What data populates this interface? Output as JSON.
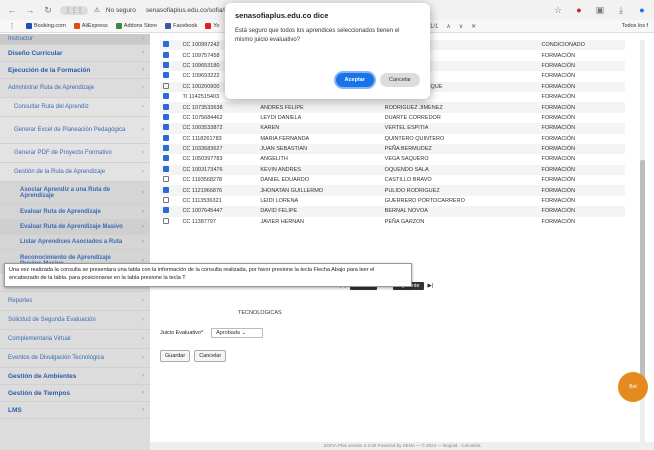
{
  "browser": {
    "url_pill": "⋮⋮⋮",
    "insecure_label": "No seguro",
    "url": "senasofiaplus.edu.co/sofia/home/principal.faces",
    "bookmarks": [
      {
        "label": "Booking.com",
        "color": "#1e4fb8"
      },
      {
        "label": "AliExpress",
        "color": "#e04b1e"
      },
      {
        "label": "Addons Store",
        "color": "#3b8b3b"
      },
      {
        "label": "Facebook",
        "color": "#3b5998"
      },
      {
        "label": "Yo",
        "color": "#e02020"
      }
    ],
    "bookmarks_right": "Todos los f",
    "find_count": "1/1"
  },
  "sidebar": {
    "items": [
      {
        "label": "Instructor",
        "kind": "top"
      },
      {
        "label": "Diseño Curricular",
        "kind": "section"
      },
      {
        "label": "Ejecución de la Formación",
        "kind": "section"
      },
      {
        "label": "Administrar Ruta de Aprendizaje",
        "kind": "plain"
      },
      {
        "label": "Consultar Ruta del Aprendiz",
        "kind": "sub"
      },
      {
        "label": "Generar Excel de Planeación Pedagógica",
        "kind": "sub"
      },
      {
        "label": "Generar PDF de Proyecto Formativo",
        "kind": "sub"
      },
      {
        "label": "Gestión de la Ruta de Aprendizaje",
        "kind": "sub"
      },
      {
        "label": "Asociar Aprendiz a una Ruta de Aprendizaje",
        "kind": "sub2"
      },
      {
        "label": "Evaluar Ruta de Aprendizaje",
        "kind": "sub2"
      },
      {
        "label": "Evaluar Ruta de Aprendizaje Masivo",
        "kind": "sub2hl"
      },
      {
        "label": "Listar Aprendices Asociados a Ruta",
        "kind": "sub2"
      },
      {
        "label": "Reconocimiento de Aprendizaje Previos Masivo",
        "kind": "sub2"
      },
      {
        "label": "S",
        "kind": "plain"
      },
      {
        "label": "Reportes",
        "kind": "plain"
      },
      {
        "label": "Solicitud de Segunda Evaluación",
        "kind": "plain"
      },
      {
        "label": "Complementaria Virtual",
        "kind": "plain"
      },
      {
        "label": "Eventos de Divulgación Tecnológica",
        "kind": "plain"
      },
      {
        "label": "Gestión de Ambientes",
        "kind": "section"
      },
      {
        "label": "Gestión de Tiempos",
        "kind": "section"
      },
      {
        "label": "LMS",
        "kind": "section"
      }
    ]
  },
  "table": {
    "rows": [
      {
        "checked": true,
        "doc": "CC 100997242",
        "nombre": "",
        "apellido": "ÑONEZ",
        "estado": "Condicionado",
        "hl": false
      },
      {
        "checked": true,
        "doc": "CC 109757458",
        "nombre": "",
        "apellido": "",
        "estado": "Formación",
        "hl": false
      },
      {
        "checked": true,
        "doc": "CC 109653180",
        "nombre": "",
        "apellido": "ZAMBRANO",
        "estado": "Formación",
        "hl": false
      },
      {
        "checked": true,
        "doc": "CC 109693222",
        "nombre": "",
        "apellido": "TINEZ",
        "estado": "Formación",
        "hl": false
      },
      {
        "checked": false,
        "doc": "CC 100200900",
        "nombre": "JOSE DARIO",
        "apellido": "VILLEGAS MANRIQUE",
        "estado": "Formación",
        "hl": true
      },
      {
        "checked": true,
        "doc": "TI 1142515403",
        "nombre": "MANUELA",
        "apellido": "NEIRA MUÑOZ",
        "estado": "Formación",
        "hl": false
      },
      {
        "checked": true,
        "doc": "CC 1073533638",
        "nombre": "ANDRES FELIPE",
        "apellido": "RODRIGUEZ JIMENEZ",
        "estado": "Formación",
        "hl": false
      },
      {
        "checked": true,
        "doc": "CC 1075684462",
        "nombre": "LEYDI DANIELA",
        "apellido": "DUARTE CORREDOR",
        "estado": "Formación",
        "hl": false
      },
      {
        "checked": true,
        "doc": "CC 1003533872",
        "nombre": "KAREN",
        "apellido": "VERTEL ESPITIA",
        "estado": "Formación",
        "hl": false
      },
      {
        "checked": true,
        "doc": "CC 1118261783",
        "nombre": "MARIA FERNANDA",
        "apellido": "QUINTERO QUINTERO",
        "estado": "Formación",
        "hl": false
      },
      {
        "checked": true,
        "doc": "CC 1033683627",
        "nombre": "JUAN SEBASTIAN",
        "apellido": "PEÑA BERMUDEZ",
        "estado": "Formación",
        "hl": false
      },
      {
        "checked": true,
        "doc": "CC 1050397783",
        "nombre": "ANGELITH",
        "apellido": "VEGA SAQUERO",
        "estado": "Formación",
        "hl": false
      },
      {
        "checked": true,
        "doc": "CC 1003173476",
        "nombre": "KEVIN ANDRES",
        "apellido": "OQUENDO SALA",
        "estado": "Formación",
        "hl": false
      },
      {
        "checked": false,
        "doc": "CC 1193568278",
        "nombre": "DANIEL EDUARDO",
        "apellido": "CASTILLO BRAVO",
        "estado": "Formación",
        "hl": false
      },
      {
        "checked": true,
        "doc": "CC 1121966876",
        "nombre": "JHONATAN GUILLERMO",
        "apellido": "PULIDO RODRIGUEZ",
        "estado": "Formación",
        "hl": false
      },
      {
        "checked": false,
        "doc": "CC 1113536321",
        "nombre": "LEIDI LORENA",
        "apellido": "GUERRERO PORTOCARRERO",
        "estado": "Formación",
        "hl": false
      },
      {
        "checked": true,
        "doc": "CC 1007645447",
        "nombre": "DAVID FELIPE",
        "apellido": "BERNAL NOVOA",
        "estado": "Formación",
        "hl": false
      },
      {
        "checked": false,
        "doc": "CC 11387797",
        "nombre": "JAVIER HERNAN",
        "apellido": "PEÑA GARZON",
        "estado": "Formación",
        "hl": false
      }
    ]
  },
  "pager": {
    "prev": "Anterior",
    "pages": "1 2",
    "next": "Siguiente"
  },
  "tooltip": {
    "line1": "Una vez realizada la consulta se presentara una tabla con la información de la consulta realizada, por favor presione la tecla Flecha Abajo para leer el",
    "line2": "encabezado de la tabla.     para posicionarse en la tabla presione la tecla T"
  },
  "behind_tooltip": "TECNOLOGICAS",
  "juicio": {
    "label": "Juicio Evaluativo*",
    "value": "Aprobada"
  },
  "buttons": {
    "save": "Guardar",
    "cancel": "Cancelar"
  },
  "footer": "SOFIA Plus versión 2.0.00 Powered by SENA — © 2024 — Bogotá · Colombia",
  "dialog": {
    "title": "senasofiaplus.edu.co dice",
    "message": "Está seguro que todos los aprendices seleccionados tienen el mismo juicio evaluativo?",
    "ok": "Aceptar",
    "cancel": "Cancelar"
  },
  "robot_label": "Bot"
}
